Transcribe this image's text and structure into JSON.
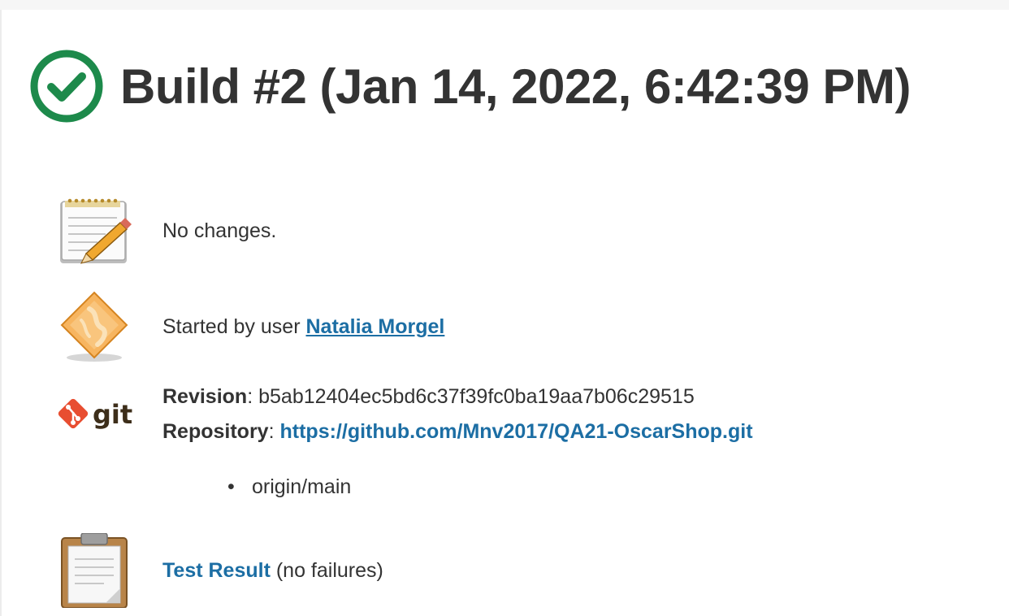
{
  "header": {
    "status_icon": "check-circle-icon",
    "status_color": "#1d8a4b",
    "title": "Build #2 (Jan 14, 2022, 6:42:39 PM)"
  },
  "changes": {
    "icon": "notepad-icon",
    "text": "No changes."
  },
  "cause": {
    "icon": "user-diamond-icon",
    "prefix": "Started by user ",
    "user_link": "Natalia Morgel"
  },
  "git": {
    "icon": "git-icon",
    "icon_color": "#e84e31",
    "logo_text": "git",
    "revision_label": "Revision",
    "revision_value": "b5ab12404ec5bd6c37f39fc0ba19aa7b06c29515",
    "repository_label": "Repository",
    "repository_url": "https://github.com/Mnv2017/QA21-OscarShop.git",
    "branches": [
      "origin/main"
    ]
  },
  "tests": {
    "icon": "clipboard-icon",
    "link": "Test Result",
    "suffix": " (no failures)"
  },
  "colors": {
    "link": "#1c6ea4",
    "text": "#333333"
  }
}
